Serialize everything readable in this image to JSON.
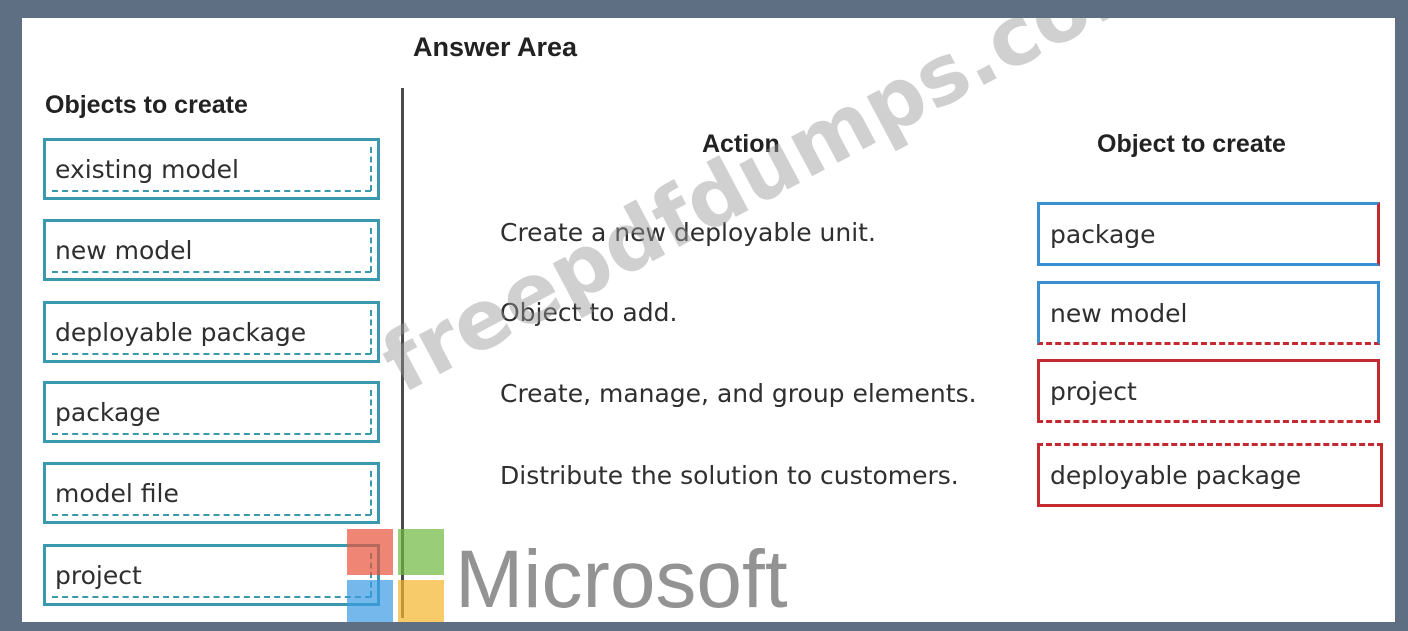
{
  "answer_area": {
    "title": "Answer Area"
  },
  "objects": {
    "title": "Objects to create",
    "items": [
      "existing model",
      "new model",
      "deployable package",
      "package",
      "model file",
      "project"
    ]
  },
  "table": {
    "action_header": "Action",
    "object_header": "Object to create",
    "rows": [
      {
        "action": "Create a new deployable unit.",
        "answer": "package"
      },
      {
        "action": "Object to add.",
        "answer": "new model"
      },
      {
        "action": "Create, manage, and group elements.",
        "answer": "project"
      },
      {
        "action": "Distribute the solution to customers.",
        "answer": "deployable package"
      }
    ]
  },
  "watermark": {
    "text": "freepdfdumps.com"
  },
  "logo": {
    "name": "Microsoft",
    "colors": [
      "#e8533b",
      "#6fb83f",
      "#3a9ae2",
      "#f5b52b"
    ]
  },
  "colors": {
    "box_border": "#3a99ad",
    "answer_blue": "#3a8fd0",
    "answer_red": "#c3292e",
    "frame": "#5f6f83"
  }
}
